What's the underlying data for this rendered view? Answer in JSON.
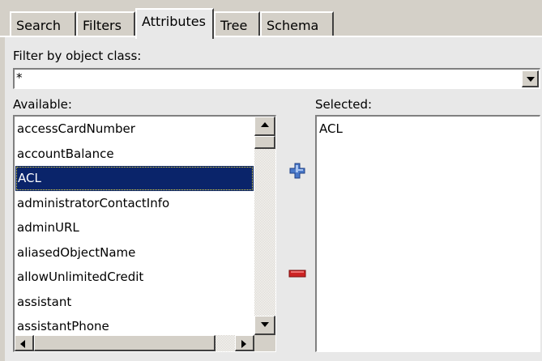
{
  "tabs": [
    {
      "label": "Search",
      "active": false
    },
    {
      "label": "Filters",
      "active": false
    },
    {
      "label": "Attributes",
      "active": true
    },
    {
      "label": "Tree",
      "active": false
    },
    {
      "label": "Schema",
      "active": false
    }
  ],
  "filter": {
    "label": "Filter by object class:",
    "value": "*"
  },
  "available": {
    "label": "Available:",
    "items": [
      "accessCardNumber",
      "accountBalance",
      "ACL",
      "administratorContactInfo",
      "adminURL",
      "aliasedObjectName",
      "allowUnlimitedCredit",
      "assistant",
      "assistantPhone"
    ],
    "selected_item": "ACL"
  },
  "selected": {
    "label": "Selected:",
    "items": [
      "ACL"
    ]
  },
  "colors": {
    "background": "#d4d0c8",
    "panel": "#e8e8e8",
    "selection": "#0a246a",
    "add_icon": "#4a78c8",
    "remove_icon": "#cc2222"
  },
  "icons": {
    "add": "plus-icon",
    "remove": "minus-icon"
  }
}
